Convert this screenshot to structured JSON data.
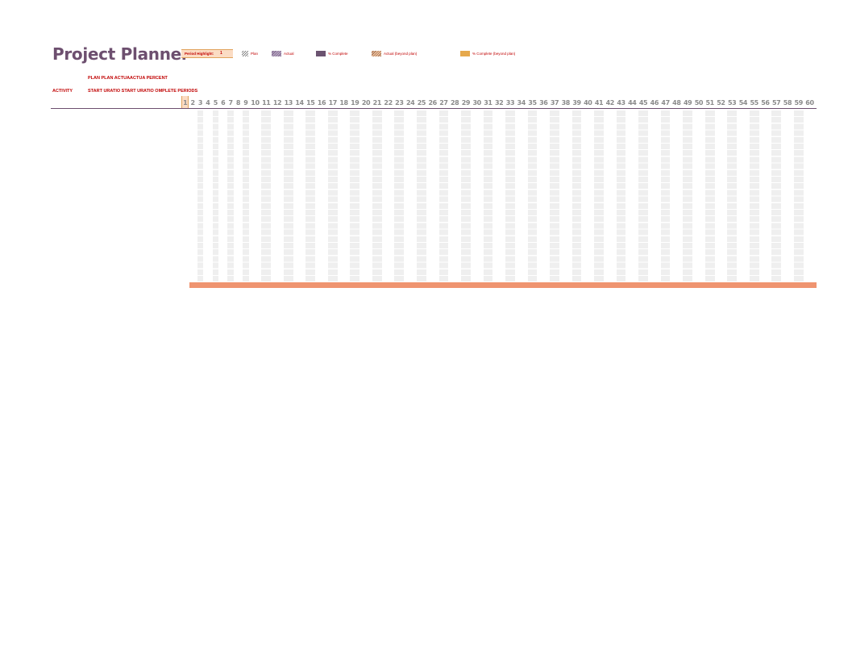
{
  "title": "Project Planner",
  "period_highlight": {
    "label": "Period Highlight:",
    "value": "1"
  },
  "legend": [
    {
      "key": "plan",
      "label": "Plan"
    },
    {
      "key": "actual",
      "label": "Actual"
    },
    {
      "key": "complete",
      "label": "% Complete"
    },
    {
      "key": "beyond",
      "label": "Actual (beyond plan)"
    },
    {
      "key": "complete_beyond",
      "label": "% Complete (beyond plan)"
    }
  ],
  "colors": {
    "title": "#6d4f6f",
    "header_text": "#c00000",
    "highlight_fill": "#fbdcc4",
    "highlight_border": "#e1a35c",
    "complete": "#6b5370",
    "complete_beyond": "#e6a94c",
    "bottom_bar": "#ef9470",
    "shade": "#efefef"
  },
  "headers": {
    "activity": "ACTIVITY",
    "row1": "PLAN  PLAN ACTUAACTUA PERCENT",
    "row2": "START URATIO START URATIO OMPLETE PERIODS"
  },
  "periods": [
    1,
    2,
    3,
    4,
    5,
    6,
    7,
    8,
    9,
    10,
    11,
    12,
    13,
    14,
    15,
    16,
    17,
    18,
    19,
    20,
    21,
    22,
    23,
    24,
    25,
    26,
    27,
    28,
    29,
    30,
    31,
    32,
    33,
    34,
    35,
    36,
    37,
    38,
    39,
    40,
    41,
    42,
    43,
    44,
    45,
    46,
    47,
    48,
    49,
    50,
    51,
    52,
    53,
    54,
    55,
    56,
    57,
    58,
    59,
    60
  ],
  "active_period": 1
}
